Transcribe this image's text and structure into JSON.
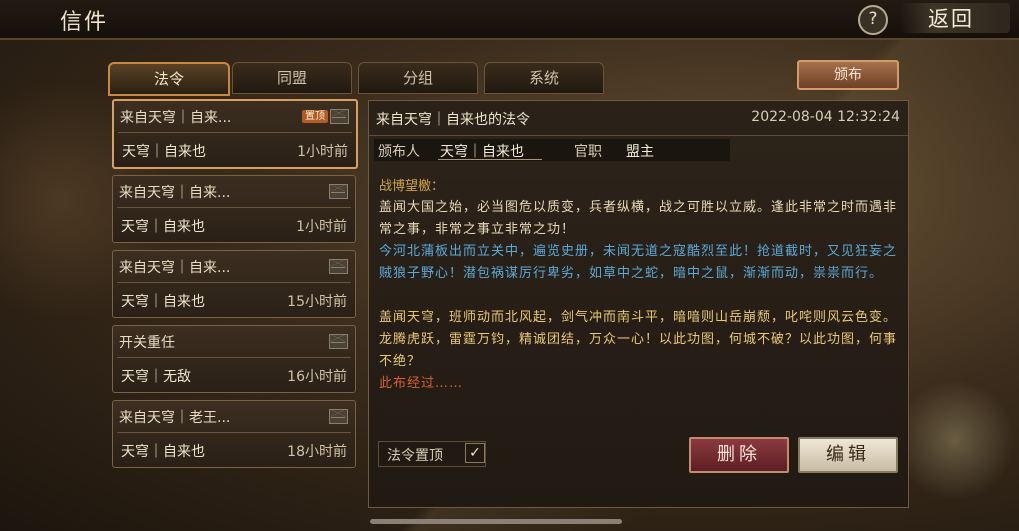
{
  "header": {
    "title": "信件",
    "help_label": "?",
    "back_label": "返回"
  },
  "tabs": [
    {
      "label": "法令",
      "active": true
    },
    {
      "label": "同盟",
      "active": false
    },
    {
      "label": "分组",
      "active": false
    },
    {
      "label": "系统",
      "active": false
    }
  ],
  "publish_label": "颁布",
  "mail_list": [
    {
      "sender": "来自天穹｜自来...",
      "from": "天穹｜自来也",
      "time": "1小时前",
      "badge": "置顶",
      "selected": true
    },
    {
      "sender": "来自天穹｜自来...",
      "from": "天穹｜自来也",
      "time": "1小时前",
      "badge": "",
      "selected": false
    },
    {
      "sender": "来自天穹｜自来...",
      "from": "天穹｜自来也",
      "time": "15小时前",
      "badge": "",
      "selected": false
    },
    {
      "sender": "开关重任",
      "from": "天穹｜无敌",
      "time": "16小时前",
      "badge": "",
      "selected": false
    },
    {
      "sender": "来自天穹｜老王...",
      "from": "天穹｜自来也",
      "time": "18小时前",
      "badge": "",
      "selected": false
    }
  ],
  "detail": {
    "title": "来自天穹｜自来也的法令",
    "datetime": "2022-08-04 12:32:24",
    "publisher_label": "颁布人",
    "publisher": "天穹｜自来也",
    "position_label": "官职",
    "position": "盟主",
    "greeting": "战博望檄：",
    "paragraphs": [
      "  盖闻大国之始，必当图危以质变，兵者纵横，战之可胜以立威。逢此非常之时而遇非常之事，非常之事立非常之功！",
      "  今河北蒲板出而立关中，遍览史册，未闻无道之寇酷烈至此！抢道截时，又见狂妄之贼狼子野心！潜包祸谋厉行卑劣，如草中之蛇，暗中之鼠，渐渐而动，祟祟而行。",
      "  盖闻天穹，班师动而北风起，剑气冲而南斗平，暗喑则山岳崩颓，叱咤则风云色变。龙腾虎跃，雷霆万钧，精诚团结，万众一心！以此功图，何城不破？以此功图，何事不绝？",
      "  此布经过……"
    ],
    "pin_toggle_label": "法令置顶",
    "pin_checked": true,
    "check_mark": "✓",
    "delete_label": "删除",
    "edit_label": "编辑"
  },
  "colors": {
    "accent": "#d8a060",
    "delete": "#7a2e33",
    "quote_blue": "#5aa9d8",
    "quote_gold": "#e9c874"
  }
}
